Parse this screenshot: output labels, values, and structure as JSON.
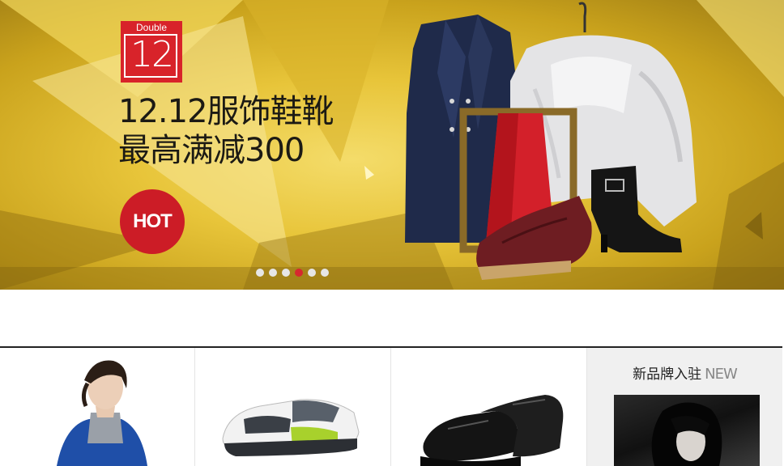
{
  "banner": {
    "badge_top": "Double",
    "badge_number": "12",
    "headline_line1": "12.12服饰鞋靴",
    "headline_line2": "最高满减300",
    "hot_label": "HOT",
    "slides": [
      {
        "active": false
      },
      {
        "active": false
      },
      {
        "active": false
      },
      {
        "active": true
      },
      {
        "active": false
      },
      {
        "active": false
      }
    ]
  },
  "strip": {
    "new_brands_title": "新品牌入驻",
    "new_brands_tag": "NEW"
  },
  "colors": {
    "accent_red": "#d6282f",
    "banner_gold": "#e8c53a"
  }
}
